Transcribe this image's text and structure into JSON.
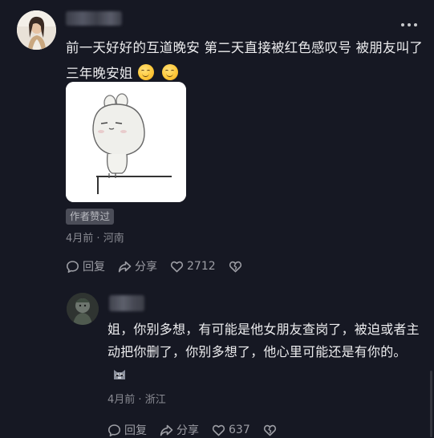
{
  "comment": {
    "text": "前一天好好的互道晚安 第二天直接被红色感叹号 被朋友叫了三年晚安姐",
    "badge": "作者赞过",
    "time": "4月前",
    "location": "河南",
    "reply_label": "回复",
    "share_label": "分享",
    "like_count": "2712"
  },
  "reply": {
    "text": "姐，你别多想，有可能是他女朋友查岗了，被迫或者主动把你删了，你别多想了，他心里可能还是有你的。",
    "time": "4月前",
    "location": "浙江",
    "reply_label": "回复",
    "share_label": "分享",
    "like_count": "637"
  },
  "icons": {
    "more": "more-dots-icon",
    "reply": "comment-bubble-icon",
    "share": "share-arrow-icon",
    "like": "heart-icon",
    "dislike": "broken-heart-icon",
    "emoji": "smiling-face-emoji",
    "reply_emoji": "cat-face-emoji"
  },
  "colors": {
    "background": "#161823",
    "text": "#ececee",
    "secondary_text": "#8a8b93",
    "badge_bg": "#4b4d58"
  }
}
